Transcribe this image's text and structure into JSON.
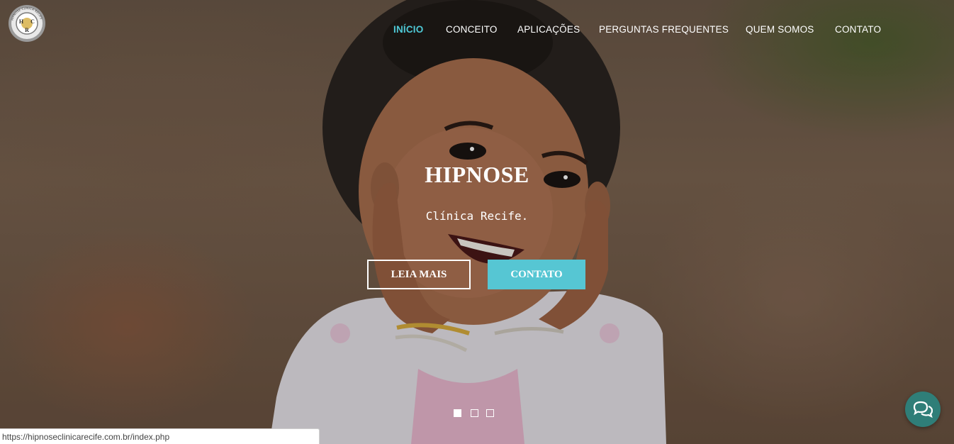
{
  "nav": {
    "items": [
      {
        "label": "INÍCIO",
        "active": true
      },
      {
        "label": "CONCEITO",
        "active": false
      },
      {
        "label": "APLICAÇÕES",
        "active": false
      },
      {
        "label": "PERGUNTAS FREQUENTES",
        "active": false
      },
      {
        "label": "QUEM SOMOS",
        "active": false
      },
      {
        "label": "CONTATO",
        "active": false
      }
    ],
    "active_color": "#4ec9d6"
  },
  "logo": {
    "letters": [
      "H",
      "C",
      "R"
    ],
    "ring_text": "HIPNOSE CLÍNICA RECIFE",
    "icon": "gear-logo-icon"
  },
  "hero": {
    "title": "HIPNOSE",
    "subtitle": "Clínica Recife.",
    "primary_button": "LEIA MAIS",
    "secondary_button": "CONTATO",
    "secondary_button_color": "#56c6d3"
  },
  "slider": {
    "slide_count": 3,
    "active_slide": 1
  },
  "chat": {
    "icon": "chat-bubbles-icon",
    "color": "#2f7e78"
  },
  "status_bar": {
    "url": "https://hipnoseclinicarecife.com.br/index.php"
  }
}
